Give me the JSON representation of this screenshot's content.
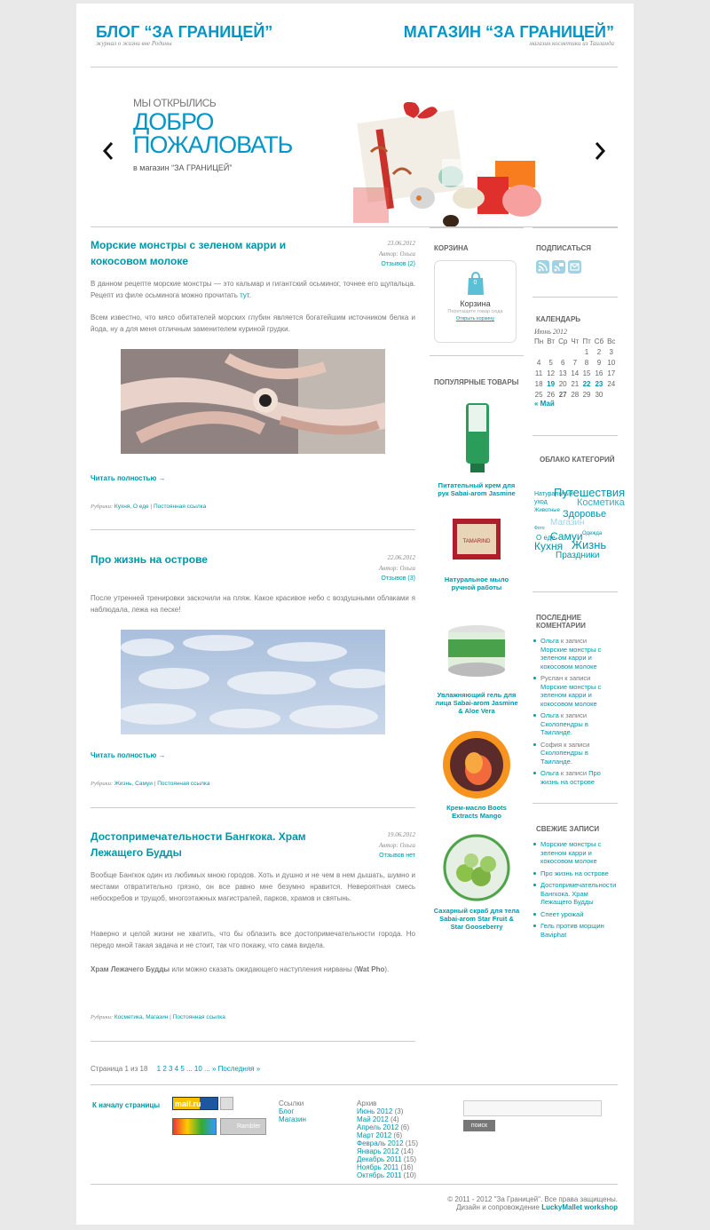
{
  "header": {
    "blog_title": "БЛОГ “ЗА ГРАНИЦЕЙ”",
    "blog_sub": "журнал о жизни вне Родины",
    "shop_title": "МАГАЗИН “ЗА ГРАНИЦЕЙ”",
    "shop_sub": "магазин косметики из Таиланда"
  },
  "slider": {
    "small": "МЫ ОТКРЫЛИСЬ",
    "big1": "ДОБРО",
    "big2": "ПОЖАЛОВАТЬ",
    "sub": "в магазин “ЗА ГРАНИЦЕЙ”"
  },
  "posts": [
    {
      "title1": "Морские монстры с зеленом карри и",
      "title2": "кокосовом молоке",
      "date": "23.06.2012",
      "author": "Автор: Ольга",
      "comments": "Отзывов (2)",
      "p1a": "В данном рецепте морские монстры — это кальмар и гигантский осьминог, точнее его щупальца. Рецепт из филе осьминога можно прочитать ",
      "p1link": "тут",
      "p1b": ".",
      "p2": "Всем известно, что мясо обитателей морских глубин является богатейшим источником белка и йода, ну а для меня отличным заменителем куриной грудки.",
      "readmore": "Читать полностью →",
      "rub_label": "Рубрики:",
      "rub": "Кухня, О еде",
      "perma": "Постоянная ссылка"
    },
    {
      "title1": "Про жизнь на острове",
      "date": "22.06.2012",
      "author": "Автор: Ольга",
      "comments": "Отзывов (3)",
      "p1": "После утренней тренировки заскочили на пляж. Какое красивое небо с воздушными облаками я наблюдала, лежа на песке!",
      "readmore": "Читать полностью →",
      "rub_label": "Рубрики:",
      "rub": "Жизнь, Самуи",
      "perma": "Постоянная ссылка"
    },
    {
      "title1": "Достопримечательности Бангкока. Храм",
      "title2": "Лежащего Будды",
      "date": "19.06.2012",
      "author": "Автор: Ольга",
      "comments": "Отзывов нет",
      "p1": "Вообще Бангкок один из любимых мною городов. Хоть и душно и не чем в нем дышать, шумно и местами отвратительно грязно, он все равно мне безумно нравится. Невероятная смесь небоскребов и трущоб, многоэтажных магистралей, парков, храмов и святынь.",
      "p2": "Наверно и целой жизни не хватить, что бы облазить все достопримечательности города. Но передо мной такая задача и не стоит, так что покажу, что сама видела.",
      "p3bold": "Храм Лежачего Будды",
      "p3": " или можно сказать ожидающего наступления нирваны (",
      "p3bold2": "Wat Pho",
      "p3end": ").",
      "rub_label": "Рубрики:",
      "rub": "Косметика, Магазин",
      "perma": "Постоянная ссылка"
    }
  ],
  "pagination": {
    "label": "Страница 1 из 18",
    "pages": "1 2 3 4 5 ... 10 ... » Последняя »"
  },
  "cart": {
    "heading": "КОРЗИНА",
    "count": "0",
    "title": "Корзина",
    "hint": "Перетащите товар сюда",
    "link": "Открыть корзину"
  },
  "popular": {
    "heading": "ПОПУЛЯРНЫЕ ТОВАРЫ",
    "items": [
      "Питательный крем для рук Sabai-arom Jasmine",
      "Натуральное мыло ручной работы",
      "Увлажняющий гель для лица Sabai-arom Jasmine & Aloe Vera",
      "Крем-масло Boots Extracts Mango",
      "Сахарный скраб для тела Sabai-arom Star Fruit & Star Gooseberry"
    ]
  },
  "subscribe": {
    "heading": "ПОДПИСАТЬСЯ"
  },
  "calendar": {
    "heading": "КАЛЕНДАРЬ",
    "month": "Июнь 2012",
    "days": [
      "Пн",
      "Вт",
      "Ср",
      "Чт",
      "Пт",
      "Сб",
      "Вс"
    ],
    "prev": "« Май",
    "rows": [
      [
        "",
        "",
        "",
        "",
        "1",
        "2",
        "3"
      ],
      [
        "4",
        "5",
        "6",
        "7",
        "8",
        "9",
        "10"
      ],
      [
        "11",
        "12",
        "13",
        "14",
        "15",
        "16",
        "17"
      ],
      [
        "18",
        "19",
        "20",
        "21",
        "22",
        "23",
        "24"
      ],
      [
        "25",
        "26",
        "27",
        "28",
        "29",
        "30",
        ""
      ]
    ]
  },
  "tags": {
    "heading": "ОБЛАКО КАТЕГОРИЙ",
    "words": [
      "Натуральный",
      "Путешествия",
      "уход",
      "Косметика",
      "Животные",
      "Здоровье",
      "Магазин",
      "Одежда",
      "О еде",
      "Самуи",
      "Кухня",
      "Жизнь",
      "Праздники",
      "Фото"
    ]
  },
  "recent_comments": {
    "heading": "ПОСЛЕДНИЕ КОМЕНТАРИИ",
    "items": [
      {
        "author": "Ольга",
        "mid": " к записи ",
        "post": "Морские монстры с зеленом карри и кокосовом молоке",
        "alink": true
      },
      {
        "author": "Руслан",
        "mid": " к записи ",
        "post": "Морские монстры с зеленом карри и кокосовом молоке",
        "alink": false
      },
      {
        "author": "Ольга",
        "mid": " к записи ",
        "post": "Сколопендры в Таиланде.",
        "alink": true
      },
      {
        "author": "София",
        "mid": " к записи ",
        "post": "Сколопендры в Таиланде.",
        "alink": false
      },
      {
        "author": "Ольга",
        "mid": " к записи ",
        "post": "Про жизнь на острове",
        "alink": true
      }
    ]
  },
  "recent_posts": {
    "heading": "СВЕЖИЕ ЗАПИСИ",
    "items": [
      "Морские монстры с зеленом карри и кокосовом молоке",
      "Про жизнь на острове",
      "Достопримечательности Бангкока. Храм Лежащего Будды",
      "Спеет урожай",
      "Гель против морщин Baviphat"
    ]
  },
  "footer": {
    "top": "К началу страницы",
    "links_h": "Ссылки",
    "links": [
      "Блог",
      "Магазин"
    ],
    "archive_h": "Архив",
    "archive": [
      {
        "m": "Июнь 2012",
        "c": "(3)"
      },
      {
        "m": "Май 2012",
        "c": "(4)"
      },
      {
        "m": "Апрель 2012",
        "c": "(6)"
      },
      {
        "m": "Март 2012",
        "c": "(6)"
      },
      {
        "m": "Февраль 2012",
        "c": "(15)"
      },
      {
        "m": "Январь 2012",
        "c": "(14)"
      },
      {
        "m": "Декабрь 2011",
        "c": "(15)"
      },
      {
        "m": "Ноябрь 2011",
        "c": "(16)"
      },
      {
        "m": "Октябрь 2011",
        "c": "(10)"
      }
    ],
    "search_btn": "поиск",
    "copy": "© 2011 - 2012 \"За Границей\". Все права защищены.",
    "credit_pre": "Дизайн и сопровождение ",
    "credit_link": "LuckyMallet workshop",
    "mail_logo": "mail.ru",
    "rambler": "Rambler"
  }
}
